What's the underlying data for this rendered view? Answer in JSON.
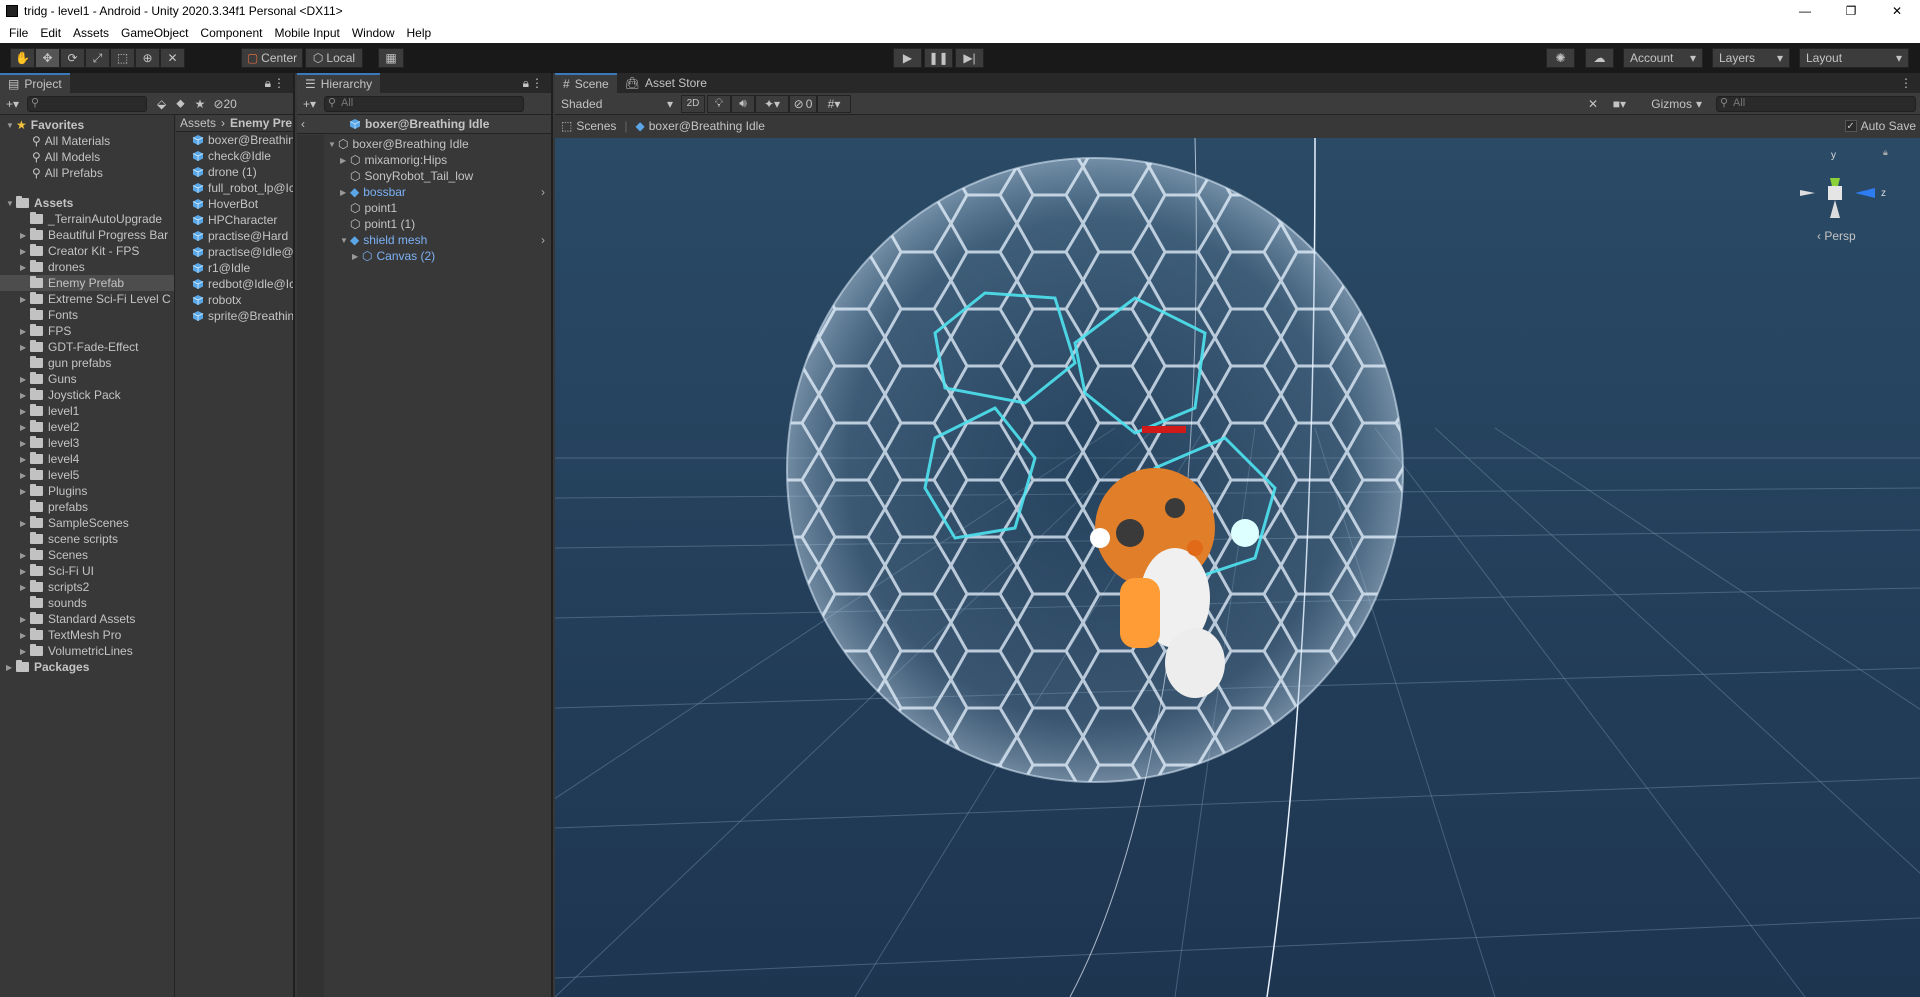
{
  "window": {
    "title": "tridg - level1 - Android - Unity 2020.3.34f1 Personal <DX11>",
    "controls": [
      "—",
      "❐",
      "✕"
    ]
  },
  "menu": [
    "File",
    "Edit",
    "Assets",
    "GameObject",
    "Component",
    "Mobile Input",
    "Window",
    "Help"
  ],
  "toolbar": {
    "pivot_label": "Center",
    "space_label": "Local",
    "account_label": "Account",
    "layers_label": "Layers",
    "layout_label": "Layout"
  },
  "project": {
    "tab": "Project",
    "hidden_count": "20",
    "favorites_label": "Favorites",
    "favorites": [
      "All Materials",
      "All Models",
      "All Prefabs"
    ],
    "assets_label": "Assets",
    "folders": [
      "_TerrainAutoUpgrade",
      "Beautiful Progress Bar",
      "Creator Kit - FPS",
      "drones",
      "Enemy Prefab",
      "Extreme Sci-Fi Level C",
      "Fonts",
      "FPS",
      "GDT-Fade-Effect",
      "gun prefabs",
      "Guns",
      "Joystick Pack",
      "level1",
      "level2",
      "level3",
      "level4",
      "level5",
      "Plugins",
      "prefabs",
      "SampleScenes",
      "scene scripts",
      "Scenes",
      "Sci-Fi UI",
      "scripts2",
      "sounds",
      "Standard Assets",
      "TextMesh Pro",
      "VolumetricLines"
    ],
    "packages_label": "Packages",
    "breadcrumb": [
      "Assets",
      "Enemy Pre"
    ],
    "files": [
      "boxer@Breathin",
      "check@Idle",
      "drone (1)",
      "full_robot_lp@Ic",
      "HoverBot",
      "HPCharacter",
      "practise@Hard",
      "practise@Idle@",
      "r1@Idle",
      "redbot@Idle@Ic",
      "robotx",
      "sprite@Breathin"
    ]
  },
  "hierarchy": {
    "tab": "Hierarchy",
    "search_placeholder": "All",
    "prefab_header": "boxer@Breathing Idle",
    "items": [
      {
        "label": "boxer@Breathing Idle"
      },
      {
        "label": "mixamorig:Hips"
      },
      {
        "label": "SonyRobot_Tail_low"
      },
      {
        "label": "bossbar"
      },
      {
        "label": "point1"
      },
      {
        "label": "point1 (1)"
      },
      {
        "label": "shield mesh"
      },
      {
        "label": "Canvas (2)"
      }
    ]
  },
  "scene": {
    "tabs": [
      "Scene",
      "Asset Store"
    ],
    "shading": "Shaded",
    "mode_2d": "2D",
    "hidden_count": "0",
    "gizmos_label": "Gizmos",
    "search_placeholder": "All",
    "breadcrumb_root": "Scenes",
    "breadcrumb_item": "boxer@Breathing Idle",
    "auto_save_label": "Auto Save",
    "auto_save": true,
    "persp_label": "Persp",
    "axes": [
      "y",
      "z"
    ]
  },
  "colors": {
    "accent": "#3a79bb",
    "prefab_blue": "#7cb1f5",
    "healthbar": "#d01a1a",
    "shield_glow": "#4fe3f0"
  }
}
